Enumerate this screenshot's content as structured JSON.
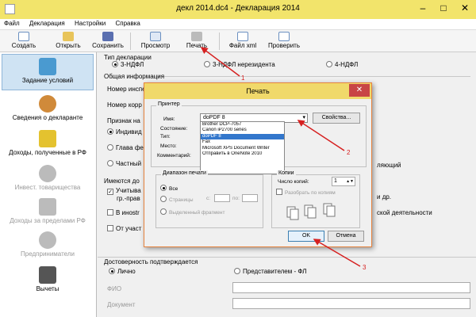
{
  "window": {
    "title": "декл 2014.dc4 - Декларация 2014",
    "buttons": [
      "–",
      "□",
      "✕"
    ]
  },
  "menu": [
    "Файл",
    "Декларация",
    "Настройки",
    "Справка"
  ],
  "toolbar": [
    {
      "label": "Создать",
      "icon": "new-doc-icon"
    },
    {
      "label": "Открыть",
      "icon": "open-folder-icon"
    },
    {
      "label": "Сохранить",
      "icon": "save-icon"
    },
    {
      "label": "Просмотр",
      "icon": "preview-icon"
    },
    {
      "label": "Печать",
      "icon": "printer-icon"
    },
    {
      "label": "Файл xml",
      "icon": "xml-file-icon"
    },
    {
      "label": "Проверить",
      "icon": "check-icon"
    }
  ],
  "sidebar": [
    {
      "label": "Задание условий",
      "active": true
    },
    {
      "label": "Сведения о декларанте"
    },
    {
      "label": "Доходы, полученные в РФ"
    },
    {
      "label": "Инвест. товарищества",
      "disabled": true
    },
    {
      "label": "Доходы за пределами РФ",
      "disabled": true
    },
    {
      "label": "Предприниматели",
      "disabled": true
    },
    {
      "label": "Вычеты"
    }
  ],
  "main": {
    "decl_type_label": "Тип декларации",
    "decl_types": [
      "3-НДФЛ",
      "3-НДФЛ нерезидента",
      "4-НДФЛ"
    ],
    "general_label": "Общая информация",
    "insp_label": "Номер инспе",
    "corr_label": "Номер корр",
    "sign_label": "Признак на",
    "sign_opts": [
      "Индивид",
      "Глава фе",
      "Частный"
    ],
    "has_label": "Имеются до",
    "has_opts": [
      "Учитыва",
      "гр.-прав",
      "В инostr",
      "От участ"
    ],
    "right_texts": [
      "и др.",
      "ской деятельности",
      "ляющий"
    ],
    "reliability_label": "Достоверность подтверждается",
    "reliability_opts": [
      "Лично",
      "Представителем - ФЛ"
    ],
    "fio_label": "ФИО",
    "doc_label": "Документ"
  },
  "print_dialog": {
    "title": "Печать",
    "printer_group": "Принтер",
    "name_label": "Имя:",
    "name_value": "doPDF 8",
    "properties_button": "Свойства...",
    "state_label": "Состояние:",
    "type_label": "Тип:",
    "place_label": "Место:",
    "comment_label": "Комментарий:",
    "printer_options": [
      "Brother DCP-7057",
      "Canon iP2700 series",
      "doPDF 8",
      "Fax",
      "Microsoft XPS Document Writer",
      "Отправить в OneNote 2010"
    ],
    "selected_index": 2,
    "range_group": "Диапазон печати",
    "range_all": "Все",
    "range_pages": "Страницы",
    "range_from": "с:",
    "range_to": "по:",
    "range_selection": "Выделенный фрагмент",
    "copies_group": "Копии",
    "copies_label": "Число копий:",
    "copies_value": "1",
    "collate_label": "Разобрать по копиям",
    "ok_button": "OK",
    "cancel_button": "Отмена"
  },
  "annotations": [
    "1",
    "2",
    "3"
  ]
}
